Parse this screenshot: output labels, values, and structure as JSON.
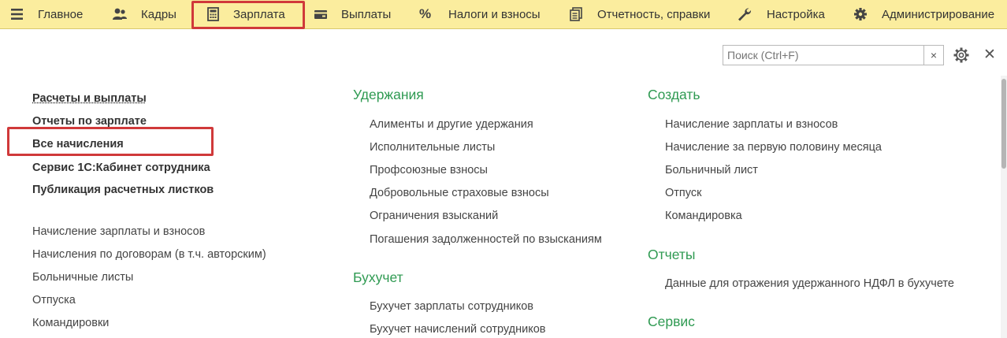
{
  "menu": {
    "items": [
      {
        "label": "Главное",
        "icon": "hamburger-icon"
      },
      {
        "label": "Кадры",
        "icon": "people-icon"
      },
      {
        "label": "Зарплата",
        "icon": "calculator-icon"
      },
      {
        "label": "Выплаты",
        "icon": "wallet-icon"
      },
      {
        "label": "Налоги и взносы",
        "icon": "percent-icon"
      },
      {
        "label": "Отчетность, справки",
        "icon": "documents-icon"
      },
      {
        "label": "Настройка",
        "icon": "wrench-icon"
      },
      {
        "label": "Администрирование",
        "icon": "gear-icon"
      }
    ]
  },
  "search": {
    "placeholder": "Поиск (Ctrl+F)",
    "clear_symbol": "×",
    "close_symbol": "✕"
  },
  "left": {
    "bold_links": [
      "Расчеты и выплаты",
      "Отчеты по зарплате",
      "Все начисления",
      "Сервис 1С:Кабинет сотрудника",
      "Публикация расчетных листков"
    ],
    "links": [
      "Начисление зарплаты и взносов",
      "Начисления по договорам (в т.ч. авторским)",
      "Больничные листы",
      "Отпуска",
      "Командировки"
    ]
  },
  "middle": {
    "uderzhaniya": {
      "title": "Удержания",
      "links": [
        "Алименты и другие удержания",
        "Исполнительные листы",
        "Профсоюзные взносы",
        "Добровольные страховые взносы",
        "Ограничения взысканий",
        "Погашения задолженностей по взысканиям"
      ]
    },
    "buhuchet": {
      "title": "Бухучет",
      "links": [
        "Бухучет зарплаты сотрудников",
        "Бухучет начислений сотрудников"
      ]
    }
  },
  "right": {
    "sozdat": {
      "title": "Создать",
      "links": [
        "Начисление зарплаты и взносов",
        "Начисление за первую половину месяца",
        "Больничный лист",
        "Отпуск",
        "Командировка"
      ]
    },
    "otchety": {
      "title": "Отчеты",
      "links": [
        "Данные для отражения удержанного НДФЛ в бухучете"
      ]
    },
    "servis": {
      "title": "Сервис"
    }
  },
  "colors": {
    "menubar": "#fbed9e",
    "highlight": "#d0393a",
    "section": "#2f9a52"
  }
}
